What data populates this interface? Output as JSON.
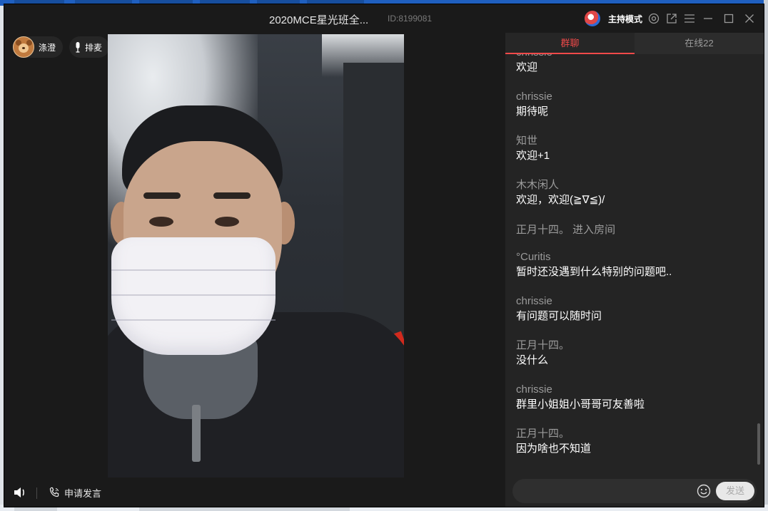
{
  "window": {
    "title": "2020MCE星光班全...",
    "room_id": "ID:8199081",
    "host_mode_label": "主持模式"
  },
  "video": {
    "user_name": "涤澄",
    "mic_queue_label": "排麦",
    "apply_speak_label": "申请发言"
  },
  "chat": {
    "tabs": [
      {
        "label": "群聊",
        "active": true
      },
      {
        "label": "在线22",
        "active": false
      }
    ],
    "messages": [
      {
        "sender": "chrissie",
        "text": "欢迎"
      },
      {
        "sender": "chrissie",
        "text": "期待呢"
      },
      {
        "sender": "知世",
        "text": "欢迎+1"
      },
      {
        "sender": "木木闲人",
        "text": "欢迎，欢迎(≧∇≦)/"
      },
      {
        "system": "正月十四。 进入房间"
      },
      {
        "sender": "°Curitis",
        "text": "暂时还没遇到什么特别的问题吧.."
      },
      {
        "sender": "chrissie",
        "text": "有问题可以随时问"
      },
      {
        "sender": "正月十四。",
        "text": "没什么"
      },
      {
        "sender": "chrissie",
        "text": "群里小姐姐小哥哥可友善啦"
      },
      {
        "sender": "正月十四。",
        "text": "因为啥也不知道"
      }
    ],
    "send_label": "发送"
  },
  "colors": {
    "accent": "#f04a4a",
    "window_bg": "#1a1a1a",
    "chat_bg": "#242424"
  },
  "icons": {
    "titlebar": [
      "host-avatar",
      "settings-icon",
      "popout-icon",
      "menu-icon",
      "minimize-icon",
      "maximize-icon",
      "close-icon"
    ],
    "bottom": [
      "speaker-icon",
      "phone-icon"
    ],
    "chat": [
      "emoji-icon"
    ]
  }
}
